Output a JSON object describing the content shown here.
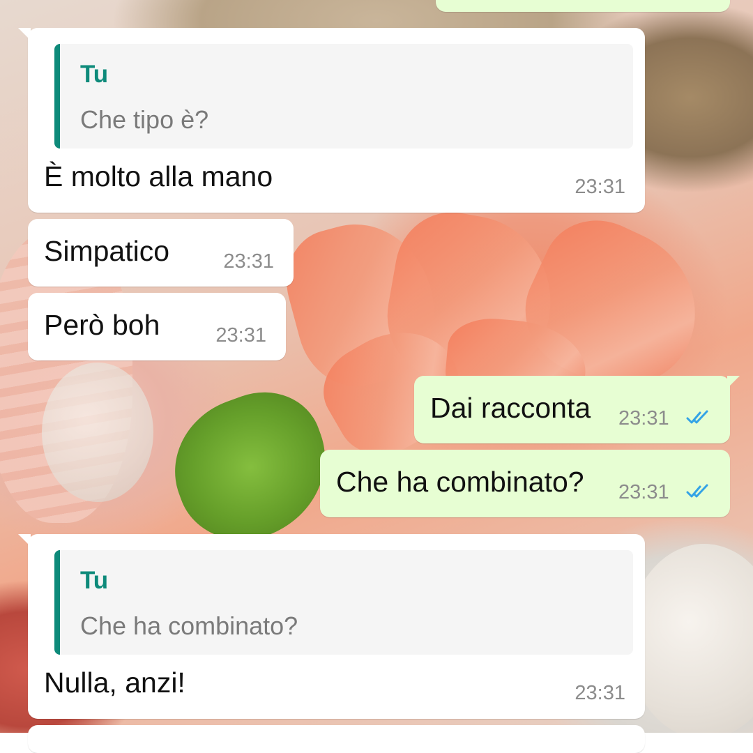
{
  "theme": {
    "incoming_bubble": "#ffffff",
    "outgoing_bubble": "#e7fed3",
    "quote_accent": "#0e8a7a",
    "timestamp": "#8c8c8c",
    "read_ticks": "#34a3e6"
  },
  "messages": [
    {
      "direction": "in",
      "reply_to": {
        "author": "Tu",
        "text": "Che tipo è?"
      },
      "text": "È molto alla mano",
      "time": "23:31"
    },
    {
      "direction": "in",
      "text": "Simpatico",
      "time": "23:31"
    },
    {
      "direction": "in",
      "text": "Però boh",
      "time": "23:31"
    },
    {
      "direction": "out",
      "text": "Dai racconta",
      "time": "23:31",
      "status": "read",
      "status_icon": "double-check-icon"
    },
    {
      "direction": "out",
      "text": "Che ha combinato?",
      "time": "23:31",
      "status": "read",
      "status_icon": "double-check-icon"
    },
    {
      "direction": "in",
      "reply_to": {
        "author": "Tu",
        "text": "Che ha combinato?"
      },
      "text": "Nulla, anzi!",
      "time": "23:31"
    }
  ]
}
